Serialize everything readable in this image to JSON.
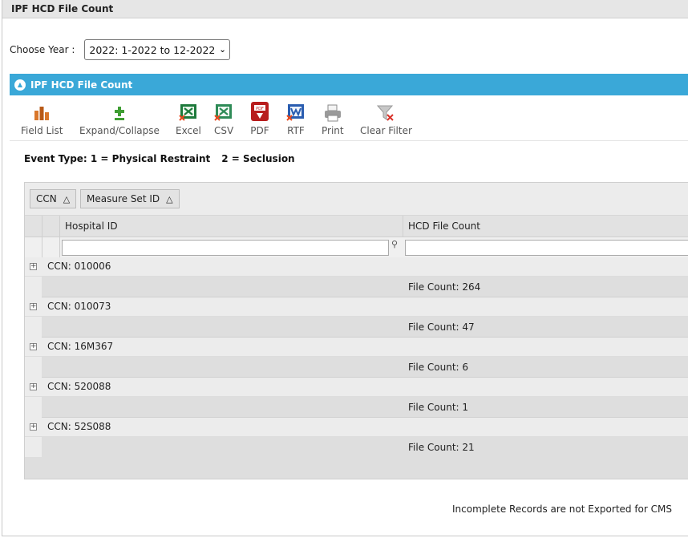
{
  "window": {
    "title": "IPF HCD File Count"
  },
  "year": {
    "label": "Choose Year :",
    "selected": "2022: 1-2022 to 12-2022"
  },
  "panel": {
    "title": "IPF HCD File Count"
  },
  "toolbar": {
    "field_list": "Field List",
    "expand_collapse": "Expand/Collapse",
    "excel": "Excel",
    "csv": "CSV",
    "pdf": "PDF",
    "rtf": "RTF",
    "print": "Print",
    "clear_filter": "Clear Filter"
  },
  "event_type": {
    "part1": "Event Type: 1 = Physical Restraint",
    "part2": "2 = Seclusion"
  },
  "grid": {
    "group_chips": [
      "CCN",
      "Measure Set ID"
    ],
    "sort_glyph": "△",
    "columns": [
      "Hospital ID",
      "HCD File Count"
    ],
    "groups": [
      {
        "label": "CCN: 010006",
        "summary": "File Count: 264"
      },
      {
        "label": "CCN: 010073",
        "summary": "File Count: 47"
      },
      {
        "label": "CCN: 16M367",
        "summary": "File Count: 6"
      },
      {
        "label": "CCN: 520088",
        "summary": "File Count: 1"
      },
      {
        "label": "CCN: 52S088",
        "summary": "File Count: 21"
      }
    ]
  },
  "note": "Incomplete Records are not Exported for CMS"
}
